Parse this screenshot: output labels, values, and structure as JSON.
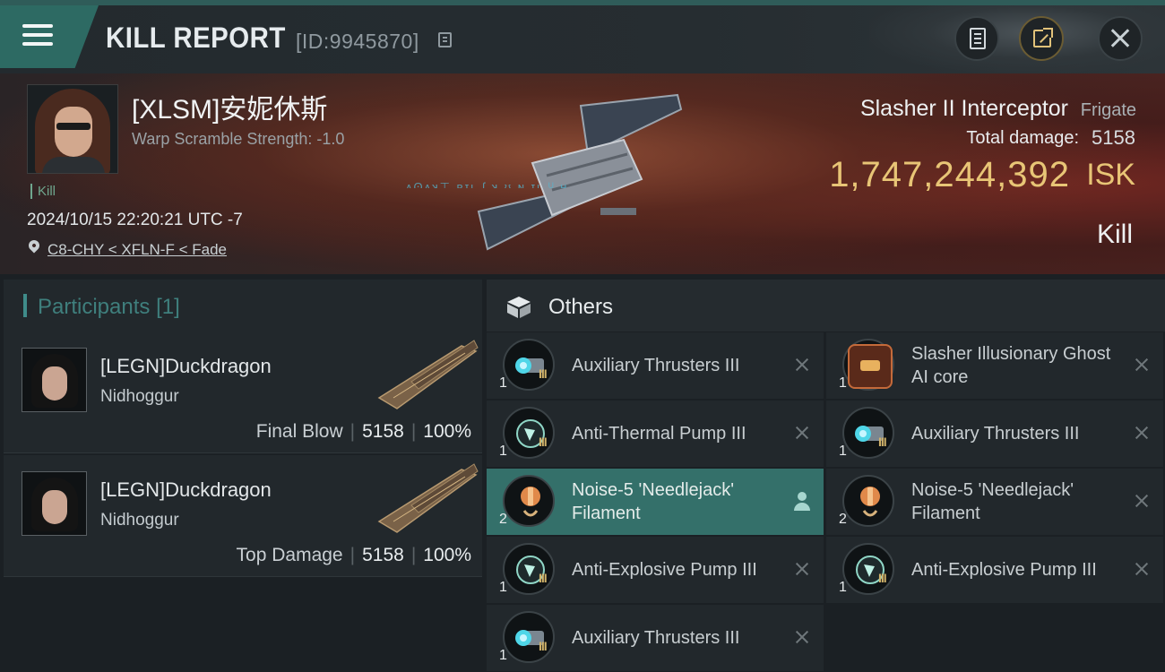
{
  "header": {
    "title": "KILL REPORT",
    "report_id": "[ID:9945870]",
    "menu_icon": "hamburger-icon",
    "actions": [
      "clipboard-icon",
      "share-icon",
      "close-icon"
    ]
  },
  "victim": {
    "name": "[XLSM]安妮休斯",
    "warp_scramble": "Warp Scramble Strength: -1.0",
    "kill_tag": "Kill",
    "datetime": "2024/10/15 22:20:21 UTC -7",
    "location": "C8-CHY < XFLN-F < Fade",
    "ship_name": "Slasher II Interceptor",
    "ship_class": "Frigate",
    "total_damage_label": "Total damage:",
    "total_damage": "5158",
    "isk_value": "1,747,244,392",
    "isk_unit": "ISK",
    "result": "Kill"
  },
  "participants": {
    "title": "Participants",
    "count": "[1]",
    "rows": [
      {
        "name": "[LEGN]Duckdragon",
        "ship": "Nidhoggur",
        "role": "Final Blow",
        "damage": "5158",
        "percent": "100%"
      },
      {
        "name": "[LEGN]Duckdragon",
        "ship": "Nidhoggur",
        "role": "Top Damage",
        "damage": "5158",
        "percent": "100%"
      }
    ]
  },
  "others": {
    "title": "Others",
    "icon": "cube-icon",
    "items": [
      {
        "name": "Auxiliary Thrusters III",
        "qty": "1",
        "tier": "III",
        "icon": "thruster-icon"
      },
      {
        "name": "Slasher Illusionary Ghost AI core",
        "qty": "1",
        "tier": "",
        "icon": "ai-core-icon"
      },
      {
        "name": "Anti-Thermal Pump III",
        "qty": "1",
        "tier": "III",
        "icon": "pump-icon"
      },
      {
        "name": "Auxiliary Thrusters III",
        "qty": "1",
        "tier": "III",
        "icon": "thruster-icon"
      },
      {
        "name": "Noise-5 'Needlejack' Filament",
        "qty": "2",
        "tier": "",
        "icon": "filament-icon",
        "selected": true
      },
      {
        "name": "Noise-5 'Needlejack' Filament",
        "qty": "2",
        "tier": "",
        "icon": "filament-icon"
      },
      {
        "name": "Anti-Explosive Pump III",
        "qty": "1",
        "tier": "III",
        "icon": "pump-icon"
      },
      {
        "name": "Anti-Explosive Pump III",
        "qty": "1",
        "tier": "III",
        "icon": "pump-icon"
      },
      {
        "name": "Auxiliary Thrusters III",
        "qty": "1",
        "tier": "III",
        "icon": "thruster-icon"
      }
    ]
  },
  "colors": {
    "accent_teal": "#2d6a63",
    "isk_gold": "#e8c576",
    "selected_row": "#34706a"
  }
}
